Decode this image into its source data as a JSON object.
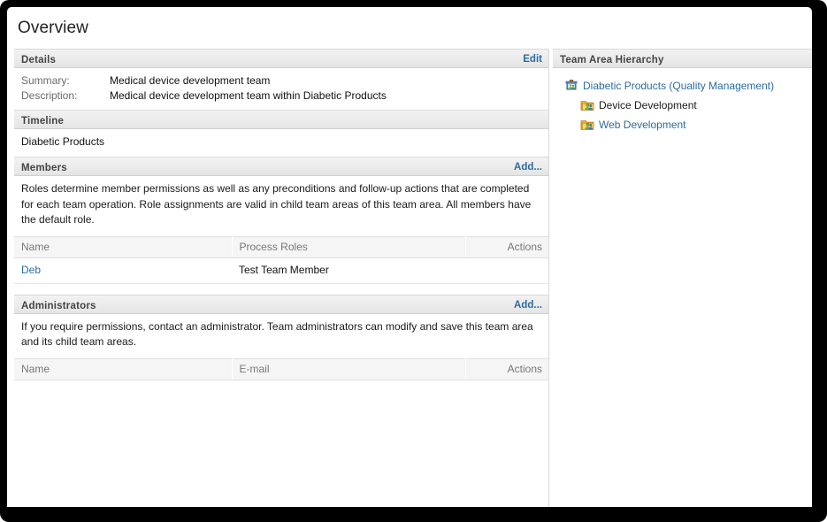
{
  "page": {
    "title": "Overview"
  },
  "details": {
    "header": "Details",
    "edit_label": "Edit",
    "fields": [
      {
        "key": "Summary:",
        "value": "Medical device development team"
      },
      {
        "key": "Description:",
        "value": "Medical device development team within Diabetic Products"
      }
    ]
  },
  "timeline": {
    "header": "Timeline",
    "value": "Diabetic Products"
  },
  "members": {
    "header": "Members",
    "add_label": "Add...",
    "blurb": "Roles determine member permissions as well as any preconditions and follow-up actions that are completed for each team operation. Role assignments are valid in child team areas of this team area. All members have the default role.",
    "columns": [
      "Name",
      "Process Roles",
      "Actions"
    ],
    "rows": [
      {
        "name": "Deb",
        "process_roles": "Test Team Member",
        "actions": ""
      }
    ]
  },
  "administrators": {
    "header": "Administrators",
    "add_label": "Add...",
    "blurb": "If you require permissions, contact an administrator. Team administrators can modify and save this team area and its child team areas.",
    "columns": [
      "Name",
      "E-mail",
      "Actions"
    ],
    "rows": []
  },
  "hierarchy": {
    "header": "Team Area Hierarchy",
    "nodes": [
      {
        "label": "Diabetic Products (Quality Management)",
        "level": 1,
        "icon": "project-area-icon",
        "is_link": true
      },
      {
        "label": "Device Development",
        "level": 2,
        "icon": "team-area-folder-icon",
        "is_link": false
      },
      {
        "label": "Web Development",
        "level": 2,
        "icon": "team-area-folder-icon",
        "is_link": true
      }
    ]
  },
  "colors": {
    "link": "#2b6ca3",
    "section_header_text": "#444444",
    "frame": "#000000",
    "table_header_bg": "#f5f5f5"
  }
}
